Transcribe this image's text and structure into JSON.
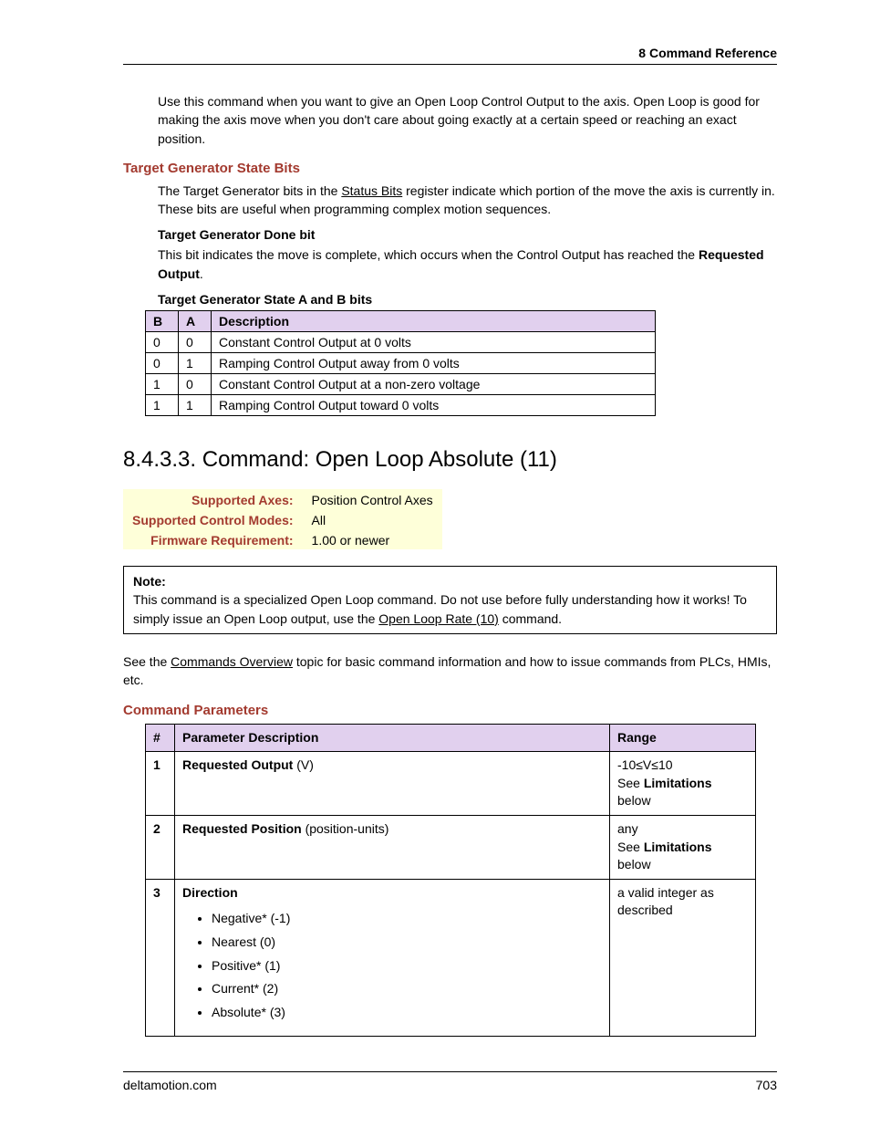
{
  "header": {
    "chapter": "8  Command Reference"
  },
  "intro_text": "Use this command when you want to give an Open Loop Control Output to the axis. Open Loop is good for making the axis move when you don't care about going exactly at a certain speed or reaching an exact position.",
  "tg": {
    "heading": "Target Generator State Bits",
    "para_pre": "The Target Generator bits in the ",
    "link": "Status Bits",
    "para_post": " register indicate which portion of the move the axis is currently in. These bits are useful when programming complex motion sequences.",
    "done_heading": "Target Generator Done bit",
    "done_text_pre": "This bit indicates the move is complete, which occurs when the Control Output has reached the ",
    "done_text_bold": "Requested Output",
    "done_text_post": ".",
    "ab_heading": "Target Generator State A and B bits",
    "cols": {
      "b": "B",
      "a": "A",
      "desc": "Description"
    },
    "rows": [
      {
        "b": "0",
        "a": "0",
        "desc": "Constant Control Output at 0 volts"
      },
      {
        "b": "0",
        "a": "1",
        "desc": "Ramping Control Output away from 0 volts"
      },
      {
        "b": "1",
        "a": "0",
        "desc": "Constant Control Output at a non-zero voltage"
      },
      {
        "b": "1",
        "a": "1",
        "desc": "Ramping Control Output toward 0 volts"
      }
    ]
  },
  "section": {
    "title": "8.4.3.3. Command: Open Loop Absolute (11)",
    "info": {
      "axes_label": "Supported Axes:",
      "axes_value": "Position Control Axes",
      "modes_label": "Supported Control Modes:",
      "modes_value": "All",
      "fw_label": "Firmware Requirement:",
      "fw_value": "1.00 or newer"
    },
    "note": {
      "label": "Note:",
      "text_pre": "This command is a specialized Open Loop command. Do not use before fully understanding how it works! To simply issue an Open Loop output, use the  ",
      "link": "Open Loop Rate (10)",
      "text_post": " command."
    },
    "see_pre": "See the ",
    "see_link": "Commands Overview",
    "see_post": " topic for basic command information and how to issue commands from PLCs, HMIs, etc.",
    "params_heading": "Command Parameters",
    "cols": {
      "num": "#",
      "desc": "Parameter Description",
      "range": "Range"
    },
    "rows": [
      {
        "num": "1",
        "desc_bold": "Requested Output",
        "desc_tail": "  (V)",
        "range_line1": "-10≤V≤10",
        "range_pre": "See ",
        "range_bold": "Limitations",
        "range_post": " below"
      },
      {
        "num": "2",
        "desc_bold": "Requested Position",
        "desc_tail": "  (position-units)",
        "range_line1": "any",
        "range_pre": "See ",
        "range_bold": "Limitations",
        "range_post": " below"
      },
      {
        "num": "3",
        "desc_bold": "Direction",
        "items": [
          "Negative* (-1)",
          "Nearest (0)",
          "Positive* (1)",
          "Current* (2)",
          "Absolute* (3)"
        ],
        "range_line1": "a valid integer as described"
      }
    ]
  },
  "footer": {
    "site": "deltamotion.com",
    "page": "703"
  }
}
